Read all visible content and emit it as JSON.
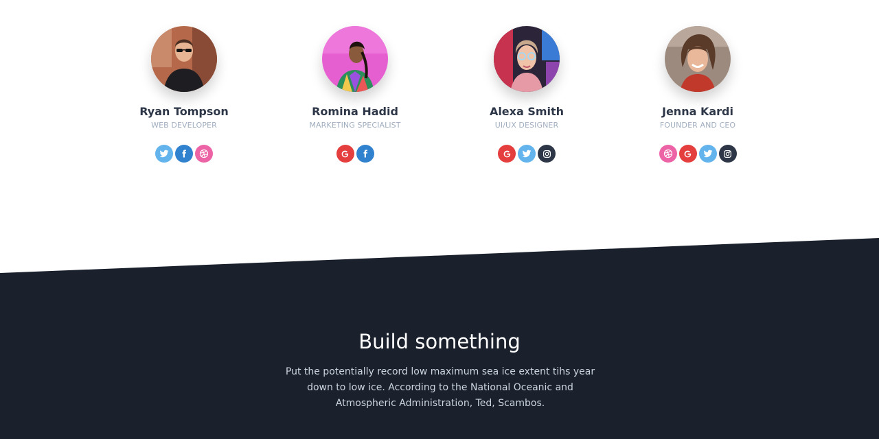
{
  "team": {
    "members": [
      {
        "name": "Ryan Tompson",
        "role": "WEB DEVELOPER",
        "socials": [
          "twitter-icon",
          "facebook-icon",
          "dribbble-icon"
        ]
      },
      {
        "name": "Romina Hadid",
        "role": "MARKETING SPECIALIST",
        "socials": [
          "google-icon",
          "facebook-icon"
        ]
      },
      {
        "name": "Alexa Smith",
        "role": "UI/UX DESIGNER",
        "socials": [
          "google-icon",
          "twitter-icon",
          "instagram-icon"
        ]
      },
      {
        "name": "Jenna Kardi",
        "role": "FOUNDER AND CEO",
        "socials": [
          "dribbble-icon",
          "google-icon",
          "twitter-icon",
          "instagram-icon"
        ]
      }
    ]
  },
  "cta": {
    "title": "Build something",
    "text": "Put the potentially record low maximum sea ice extent tihs year down to low ice. According to the National Oceanic and Atmospheric Administration, Ted, Scambos."
  },
  "colors": {
    "twitter": "#63b3ed",
    "facebook": "#3182ce",
    "dribbble": "#ed64a6",
    "google": "#e53e3e",
    "instagram": "#2d3748",
    "dark_bg": "#1a202c"
  }
}
